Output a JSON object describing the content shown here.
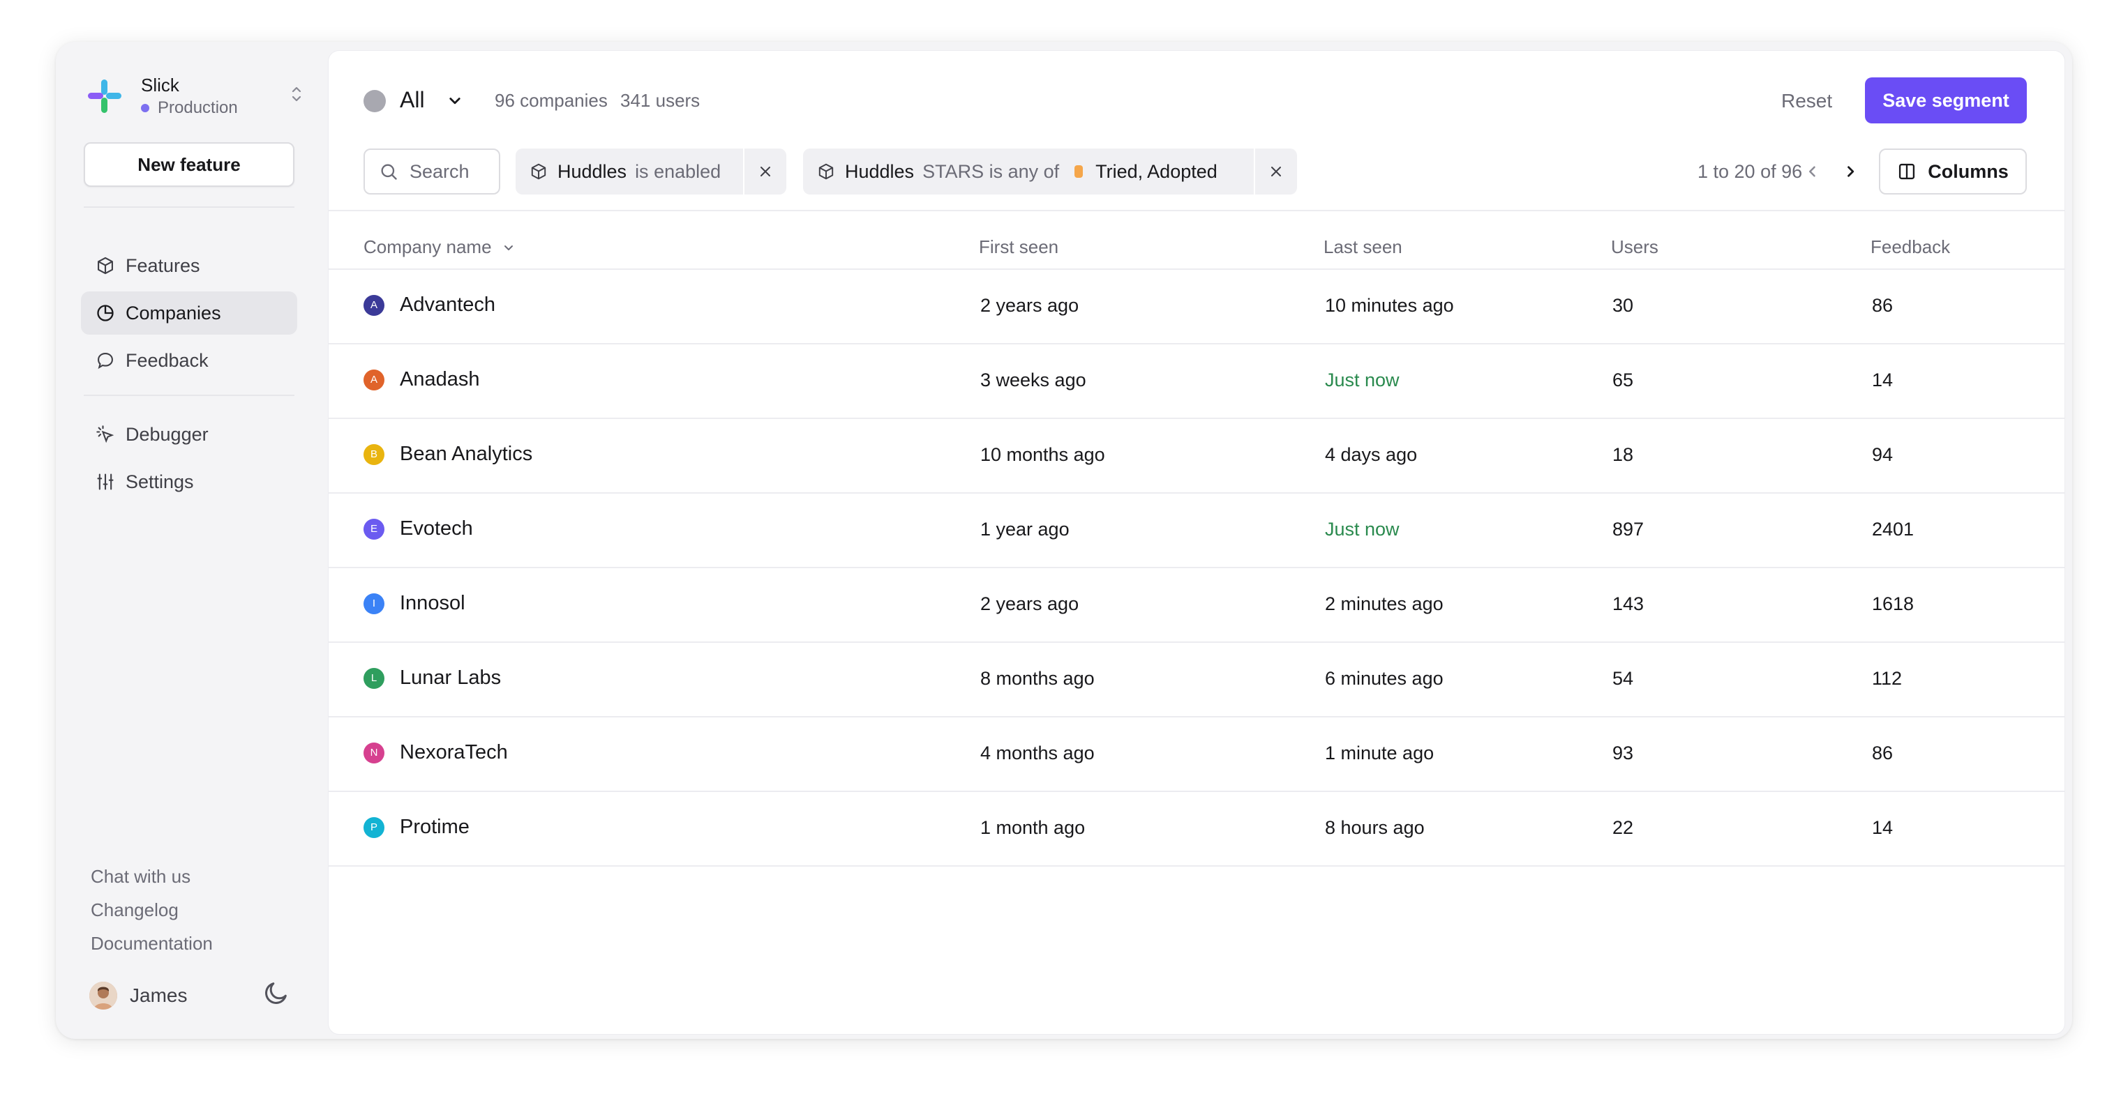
{
  "org": {
    "name": "Slick",
    "environment": "Production"
  },
  "sidebar": {
    "new_feature_label": "New feature",
    "nav": [
      {
        "label": "Features",
        "icon": "cube-icon",
        "active": false
      },
      {
        "label": "Companies",
        "icon": "pie-chart-icon",
        "active": true
      },
      {
        "label": "Feedback",
        "icon": "chat-bubble-icon",
        "active": false
      }
    ],
    "nav2": [
      {
        "label": "Debugger",
        "icon": "cursor-click-icon"
      },
      {
        "label": "Settings",
        "icon": "sliders-icon"
      }
    ],
    "footer_links": [
      "Chat with us",
      "Changelog",
      "Documentation"
    ],
    "user_name": "James"
  },
  "toolbar": {
    "segment_name": "All",
    "companies_count": "96 companies",
    "users_count": "341 users",
    "reset_label": "Reset",
    "save_label": "Save segment",
    "search_placeholder": "Search",
    "filters": [
      {
        "feature": "Huddles",
        "condition": "is enabled"
      },
      {
        "feature": "Huddles",
        "condition": "STARS is any of",
        "value": "Tried, Adopted"
      }
    ],
    "pagination": "1 to 20 of 96",
    "columns_label": "Columns"
  },
  "table": {
    "headers": [
      "Company name",
      "First seen",
      "Last seen",
      "Users",
      "Feedback"
    ],
    "rows": [
      {
        "initial": "A",
        "color": "#3b3a98",
        "name": "Advantech",
        "first_seen": "2 years ago",
        "last_seen": "10 minutes ago",
        "users": "30",
        "feedback": "86",
        "fresh": false
      },
      {
        "initial": "A",
        "color": "#e0632a",
        "name": "Anadash",
        "first_seen": "3 weeks ago",
        "last_seen": "Just now",
        "users": "65",
        "feedback": "14",
        "fresh": true
      },
      {
        "initial": "B",
        "color": "#e9b40f",
        "name": "Bean Analytics",
        "first_seen": "10 months ago",
        "last_seen": "4 days ago",
        "users": "18",
        "feedback": "94",
        "fresh": false
      },
      {
        "initial": "E",
        "color": "#6b5bf0",
        "name": "Evotech",
        "first_seen": "1 year ago",
        "last_seen": "Just now",
        "users": "897",
        "feedback": "2401",
        "fresh": true
      },
      {
        "initial": "I",
        "color": "#3b82f6",
        "name": "Innosol",
        "first_seen": "2 years ago",
        "last_seen": "2 minutes ago",
        "users": "143",
        "feedback": "1618",
        "fresh": false
      },
      {
        "initial": "L",
        "color": "#2f9e5e",
        "name": "Lunar Labs",
        "first_seen": "8 months ago",
        "last_seen": "6 minutes ago",
        "users": "54",
        "feedback": "112",
        "fresh": false
      },
      {
        "initial": "N",
        "color": "#d6408f",
        "name": "NexoraTech",
        "first_seen": "4 months ago",
        "last_seen": "1 minute ago",
        "users": "93",
        "feedback": "86",
        "fresh": false
      },
      {
        "initial": "P",
        "color": "#12b3d3",
        "name": "Protime",
        "first_seen": "1 month ago",
        "last_seen": "8 hours ago",
        "users": "22",
        "feedback": "14",
        "fresh": false
      }
    ]
  }
}
